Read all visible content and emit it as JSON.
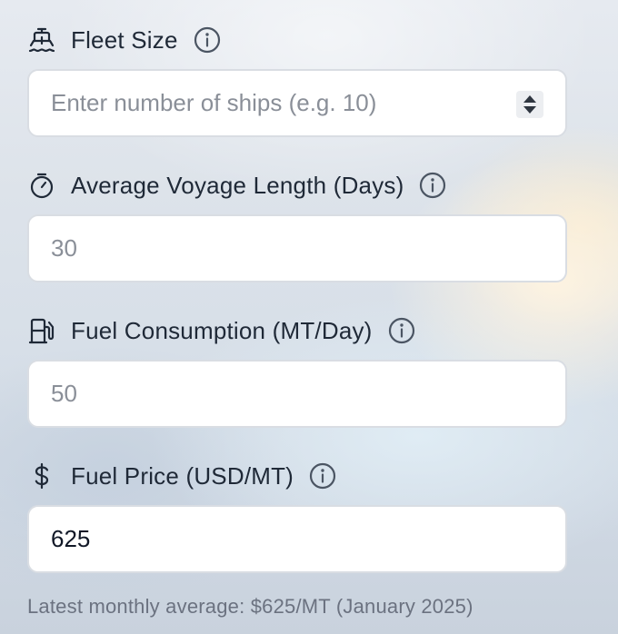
{
  "fields": [
    {
      "icon": "ship-icon",
      "label": "Fleet Size",
      "placeholder": "Enter number of ships (e.g. 10)",
      "value": "",
      "has_spinner": true
    },
    {
      "icon": "stopwatch-icon",
      "label": "Average Voyage Length (Days)",
      "placeholder": "30",
      "value": ""
    },
    {
      "icon": "fuel-pump-icon",
      "label": "Fuel Consumption (MT/Day)",
      "placeholder": "50",
      "value": ""
    },
    {
      "icon": "dollar-icon",
      "label": "Fuel Price (USD/MT)",
      "placeholder": "",
      "value": "625"
    }
  ],
  "fuel_price_helper": "Latest monthly average: $625/MT (January 2025)",
  "colors": {
    "label_text": "#1f2937",
    "placeholder_text": "#8a8f98",
    "input_border": "#d9dde3",
    "helper_text": "#6b7280"
  }
}
